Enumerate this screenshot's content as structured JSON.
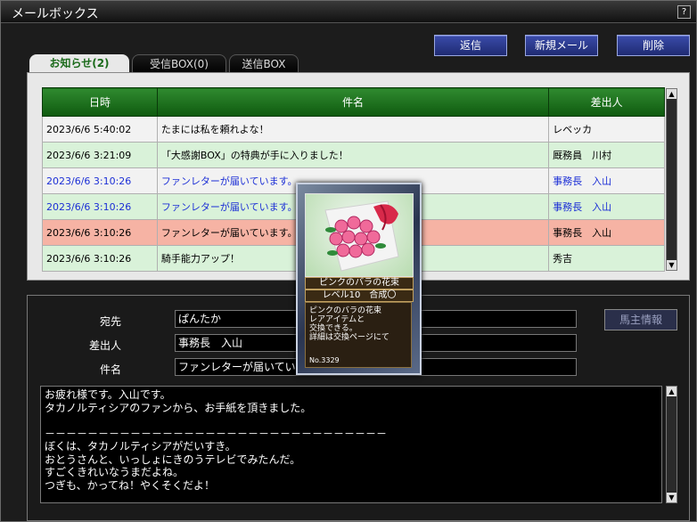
{
  "window": {
    "title": "メールボックス",
    "help": "?"
  },
  "toolbar": {
    "reply": "返信",
    "new_mail": "新規メール",
    "delete": "削除"
  },
  "tabs": [
    {
      "label": "お知らせ(2)",
      "active": true
    },
    {
      "label": "受信BOX(0)",
      "active": false
    },
    {
      "label": "送信BOX",
      "active": false
    }
  ],
  "table": {
    "headers": {
      "date": "日時",
      "subject": "件名",
      "sender": "差出人"
    },
    "rows": [
      {
        "date": "2023/6/6 5:40:02",
        "subject": "たまには私を頼れよな！",
        "sender": "レベッカ"
      },
      {
        "date": "2023/6/6 3:21:09",
        "subject": "「大感謝BOX」の特典が手に入りました！",
        "sender": "厩務員　川村"
      },
      {
        "date": "2023/6/6 3:10:26",
        "subject": "ファンレターが届いています。",
        "sender": "事務長　入山"
      },
      {
        "date": "2023/6/6 3:10:26",
        "subject": "ファンレターが届いています。",
        "sender": "事務長　入山"
      },
      {
        "date": "2023/6/6 3:10:26",
        "subject": "ファンレターが届いています。",
        "sender": "事務長　入山"
      },
      {
        "date": "2023/6/6 3:10:26",
        "subject": "騎手能力アップ！",
        "sender": "秀吉"
      }
    ]
  },
  "detail": {
    "to_label": "宛先",
    "to_value": "ぱんたか",
    "from_label": "差出人",
    "from_value": "事務長　入山",
    "subject_label": "件名",
    "subject_value": "ファンレターが届いています。",
    "horse_info_button": "馬主情報",
    "body_lines": [
      "お疲れ様です。入山です。",
      "タカノルティシアのファンから、お手紙を頂きました。",
      "",
      "－－－－－－－－－－－－－－－－－－－－－－－－－－－－－－－－",
      "ぼくは、タカノルティシアがだいすき。",
      "おとうさんと、いっしょにきのうテレビでみたんだ。",
      "すごくきれいなうまだよね。",
      "つぎも、かってね！やくそくだよ！"
    ]
  },
  "card": {
    "name": "ピンクのバラの花束",
    "level": "レベル10　合成〇",
    "desc_lines": [
      "ピンクのバラの花束",
      "レアアイテムと",
      "交換できる。",
      "詳細は交換ページにて"
    ],
    "number": "No.3329"
  },
  "colors": {
    "header_green": "#1f7a1f",
    "row_green": "#d9f2d9",
    "row_highlight": "#f6b3a4",
    "link_blue": "#1c2fd6",
    "button_blue": "#2a3a96"
  }
}
